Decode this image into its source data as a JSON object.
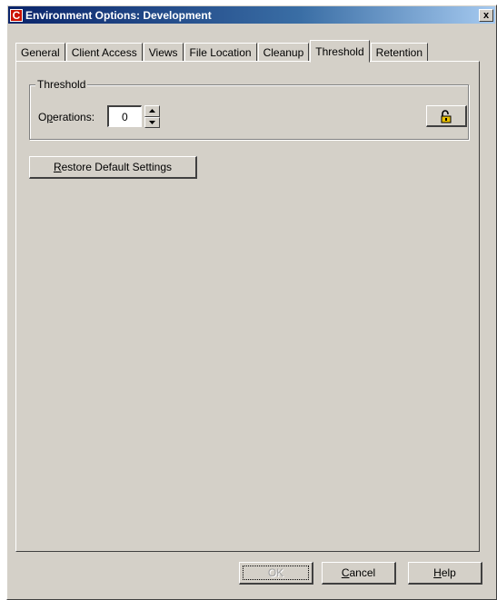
{
  "window": {
    "title": "Environment Options: Development",
    "icon_letter": "C",
    "close_glyph": "x"
  },
  "tabs": [
    {
      "label": "General",
      "active": false
    },
    {
      "label": "Client Access",
      "active": false
    },
    {
      "label": "Views",
      "active": false
    },
    {
      "label": "File Location",
      "active": false
    },
    {
      "label": "Cleanup",
      "active": false
    },
    {
      "label": "Threshold",
      "active": true
    },
    {
      "label": "Retention",
      "active": false
    }
  ],
  "threshold_group": {
    "legend": "Threshold",
    "operations_label_pre": "O",
    "operations_label_mnemonic": "p",
    "operations_label_post": "erations:",
    "operations_value": "0",
    "lock_icon": "unlocked-padlock-icon"
  },
  "restore_button": {
    "mnemonic": "R",
    "rest": "estore Default Settings"
  },
  "footer": {
    "ok_label": "OK",
    "ok_enabled": false,
    "cancel_mnemonic": "C",
    "cancel_rest": "ancel",
    "help_mnemonic": "H",
    "help_rest": "elp"
  },
  "colors": {
    "face": "#d4d0c8",
    "title_start": "#0a246a",
    "title_end": "#a6caf0",
    "icon_red": "#cc1100",
    "lock_yellow": "#e8c000"
  }
}
